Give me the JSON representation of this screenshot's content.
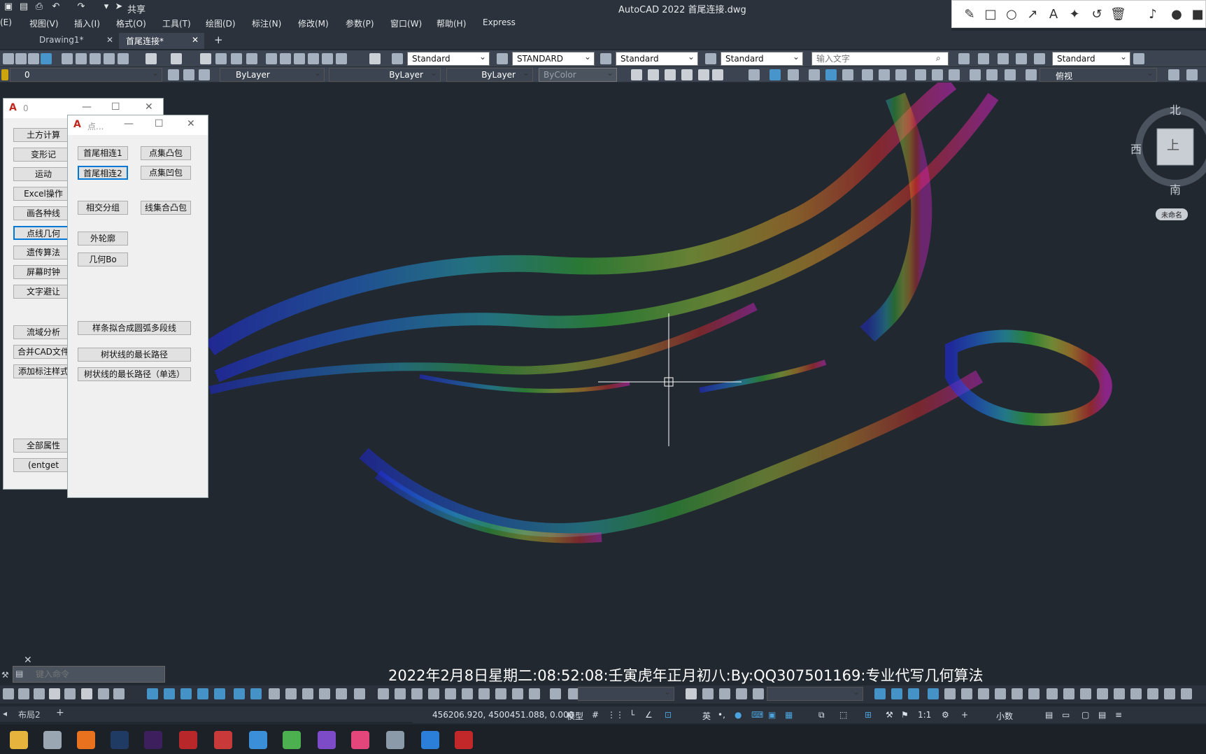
{
  "title": "AutoCAD 2022    首尾连接.dwg",
  "quick_access": {
    "share": "共享"
  },
  "menu": [
    "(E)",
    "视图(V)",
    "插入(I)",
    "格式(O)",
    "工具(T)",
    "绘图(D)",
    "标注(N)",
    "修改(M)",
    "参数(P)",
    "窗口(W)",
    "帮助(H)",
    "Express"
  ],
  "tabs": [
    {
      "label": "Drawing1*"
    },
    {
      "label": "首尾连接*"
    }
  ],
  "toolbar1": {
    "text_style": "Standard",
    "dim_style": "STANDARD",
    "table_style": "Standard",
    "multileader_style": "Standard",
    "search_placeholder": "输入文字",
    "style5": "Standard"
  },
  "toolbar2": {
    "layer": "0",
    "color": "ByLayer",
    "linetype": "ByLayer",
    "lineweight": "ByLayer",
    "plot_style": "ByColor",
    "view": "俯视"
  },
  "dialog_main": {
    "caption": "0",
    "buttons": [
      "土方计算",
      "变形记",
      "运动",
      "Excel操作",
      "画各种线",
      "点线几何",
      "遗传算法",
      "屏幕时钟",
      "文字避让",
      "流域分析",
      "合并CAD文件",
      "添加标注样式",
      "全部属性",
      "(entget"
    ]
  },
  "dialog_point": {
    "caption": "点...",
    "buttons": [
      "首尾相连1",
      "点集凸包",
      "首尾相连2",
      "点集凹包",
      "相交分组",
      "线集合凸包",
      "外轮廓",
      "几何Bo",
      "样条拟合成圆弧多段线",
      "树状线的最长路径",
      "树状线的最长路径（单选）"
    ]
  },
  "compass": {
    "north": "北",
    "west": "西",
    "south": "南",
    "top": "上",
    "ucs": "未命名"
  },
  "command_placeholder": "键入命令",
  "overlay_text": "2022年2月8日星期二:08:52:08:壬寅虎年正月初八:By:QQ307501169:专业代写几何算法",
  "layout_tabs": [
    "布局2"
  ],
  "status": {
    "coords": "456206.920, 4500451.088, 0.000",
    "model": "模型",
    "scale": "1:1",
    "units": "小数",
    "ime": "英"
  },
  "colors": {
    "background": "#212830",
    "panel": "#3b4450",
    "accent": "#0078d7"
  }
}
